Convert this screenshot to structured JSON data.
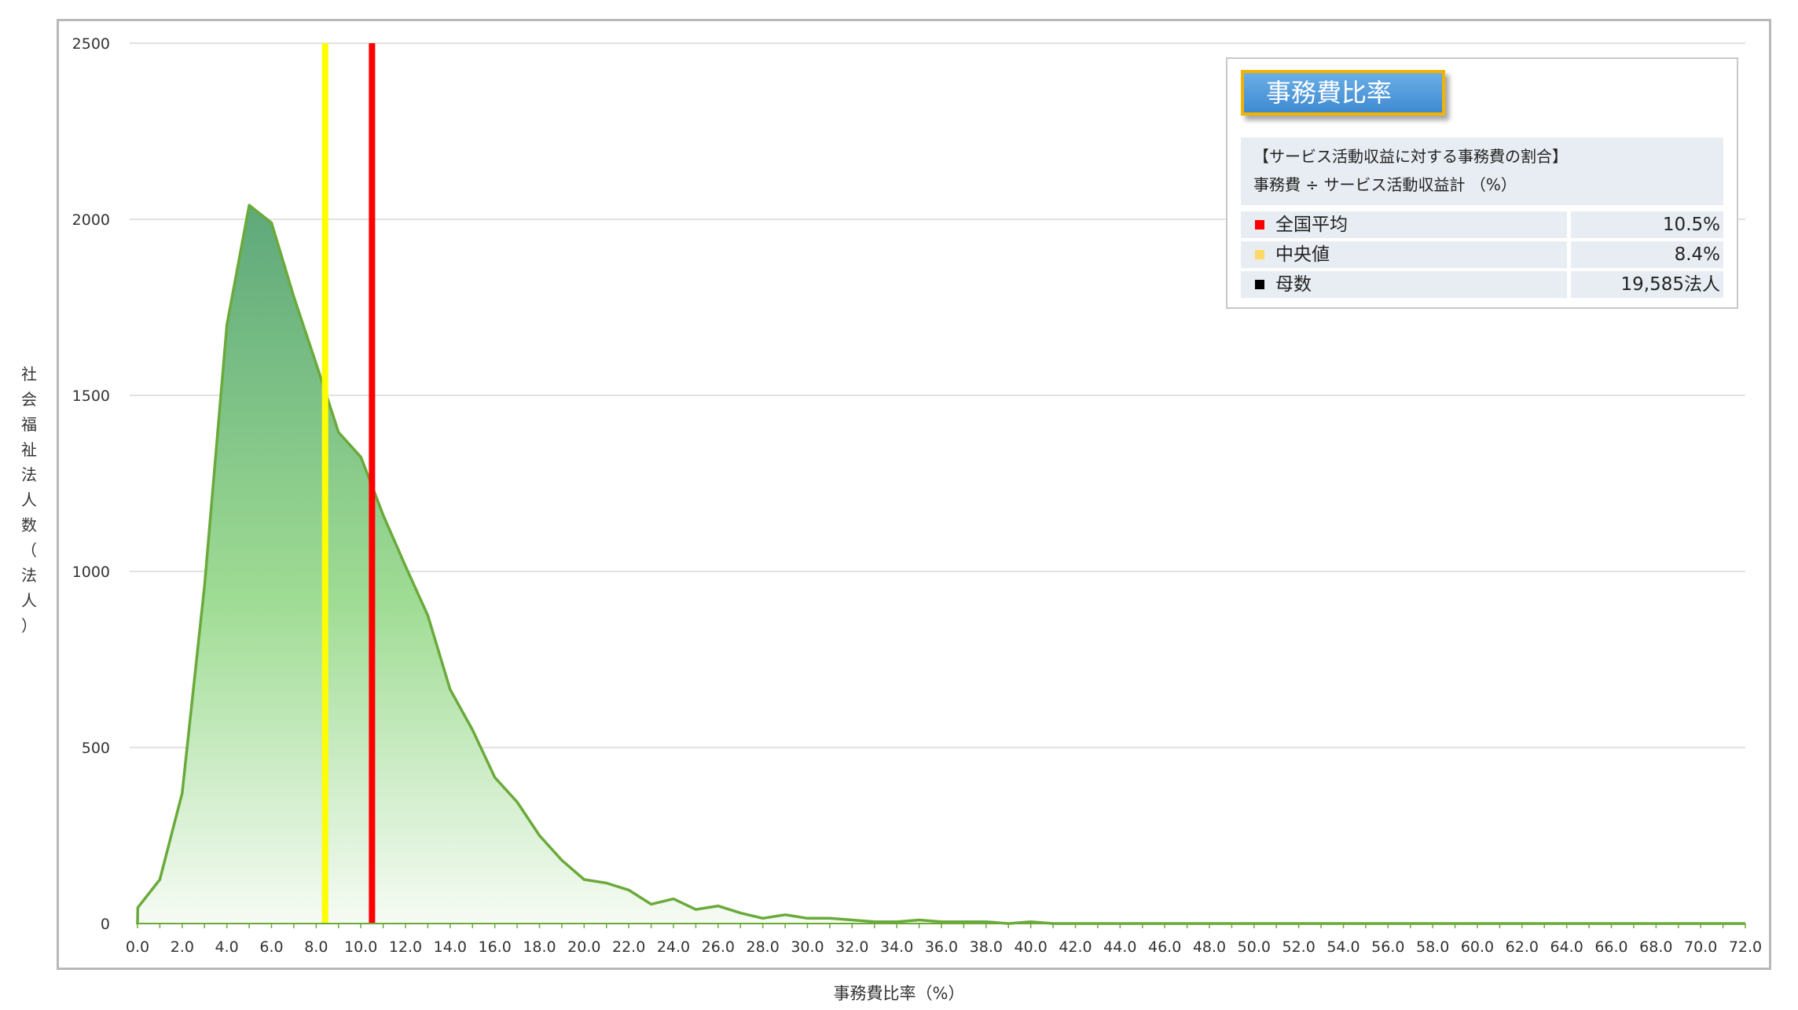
{
  "chart_data": {
    "type": "area",
    "xlabel": "事務費比率（%）",
    "ylabel": "社会福祉法人数（法人）",
    "xlim": [
      0,
      72
    ],
    "ylim": [
      0,
      2500
    ],
    "y_ticks": [
      "0",
      "500",
      "1000",
      "1500",
      "2000",
      "2500"
    ],
    "x_ticks": [
      "0.0",
      "2.0",
      "4.0",
      "6.0",
      "8.0",
      "10.0",
      "12.0",
      "14.0",
      "16.0",
      "18.0",
      "20.0",
      "22.0",
      "24.0",
      "26.0",
      "28.0",
      "30.0",
      "32.0",
      "34.0",
      "36.0",
      "38.0",
      "40.0",
      "42.0",
      "44.0",
      "46.0",
      "48.0",
      "50.0",
      "52.0",
      "54.0",
      "56.0",
      "58.0",
      "60.0",
      "62.0",
      "64.0",
      "66.0",
      "68.0",
      "70.0",
      "72.0"
    ],
    "grid": true,
    "x": [
      0,
      0.01,
      1,
      2,
      3,
      4,
      5,
      6,
      7,
      8,
      9,
      10,
      11,
      12,
      13,
      14,
      15,
      16,
      17,
      18,
      19,
      20,
      21,
      22,
      23,
      24,
      25,
      26,
      27,
      28,
      29,
      30,
      31,
      32,
      33,
      34,
      35,
      36,
      37,
      38,
      39,
      40,
      41,
      42,
      43,
      44,
      45,
      46,
      47,
      48,
      49,
      50,
      51,
      52,
      53,
      54,
      55,
      56,
      57,
      58,
      59,
      60,
      61,
      62,
      63,
      64,
      65,
      66,
      67,
      68,
      69,
      70,
      71,
      72
    ],
    "values": [
      0,
      45,
      125,
      370,
      960,
      1700,
      2040,
      1990,
      1780,
      1590,
      1395,
      1325,
      1160,
      1015,
      875,
      665,
      550,
      415,
      345,
      250,
      180,
      125,
      115,
      95,
      55,
      70,
      40,
      50,
      30,
      15,
      25,
      15,
      15,
      10,
      5,
      5,
      10,
      5,
      5,
      5,
      0,
      5,
      0,
      0,
      0,
      0,
      0,
      0,
      0,
      0,
      0,
      0,
      0,
      0,
      0,
      0,
      0,
      0,
      0,
      0,
      0,
      0,
      0,
      0,
      0,
      0,
      0,
      0,
      0,
      0,
      0,
      0,
      0,
      0
    ],
    "reference_lines": [
      {
        "name": "中央値",
        "x": 8.4,
        "color": "#ffff00"
      },
      {
        "name": "全国平均",
        "x": 10.5,
        "color": "#ff0000"
      }
    ],
    "line_color": "#6aaa3a",
    "fill_top_color": "#5ea87a",
    "fill_mid_color": "#9fdc94"
  },
  "info": {
    "title": "事務費比率",
    "desc_line1": "【サービス活動収益に対する事務費の割合】",
    "desc_line2": "事務費 ÷ サービス活動収益計 （%）",
    "rows": [
      {
        "label": "全国平均",
        "value": "10.5%",
        "color": "#ff0000"
      },
      {
        "label": "中央値",
        "value": "8.4%",
        "color": "#ffd966"
      },
      {
        "label": "母数",
        "value": "19,585法人",
        "color": "#000000"
      }
    ]
  }
}
